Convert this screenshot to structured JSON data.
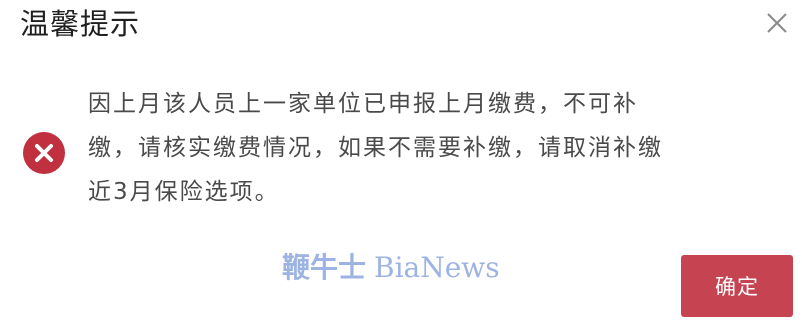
{
  "dialog": {
    "title": "温馨提示",
    "close_icon": "close-icon",
    "error_icon": "error-circle-icon",
    "message_lines": [
      "因上月该人员上一家单位已申报上月缴费，不可补",
      "缴，请核实缴费情况，如果不需要补缴，请取消补缴",
      "近3月保险选项。"
    ],
    "watermark_cn": "鞭牛士",
    "watermark_en": "BiaNews",
    "confirm_label": "确定",
    "colors": {
      "error": "#c0303f",
      "confirm_button": "#c64452",
      "watermark": "#8da6dc"
    }
  }
}
